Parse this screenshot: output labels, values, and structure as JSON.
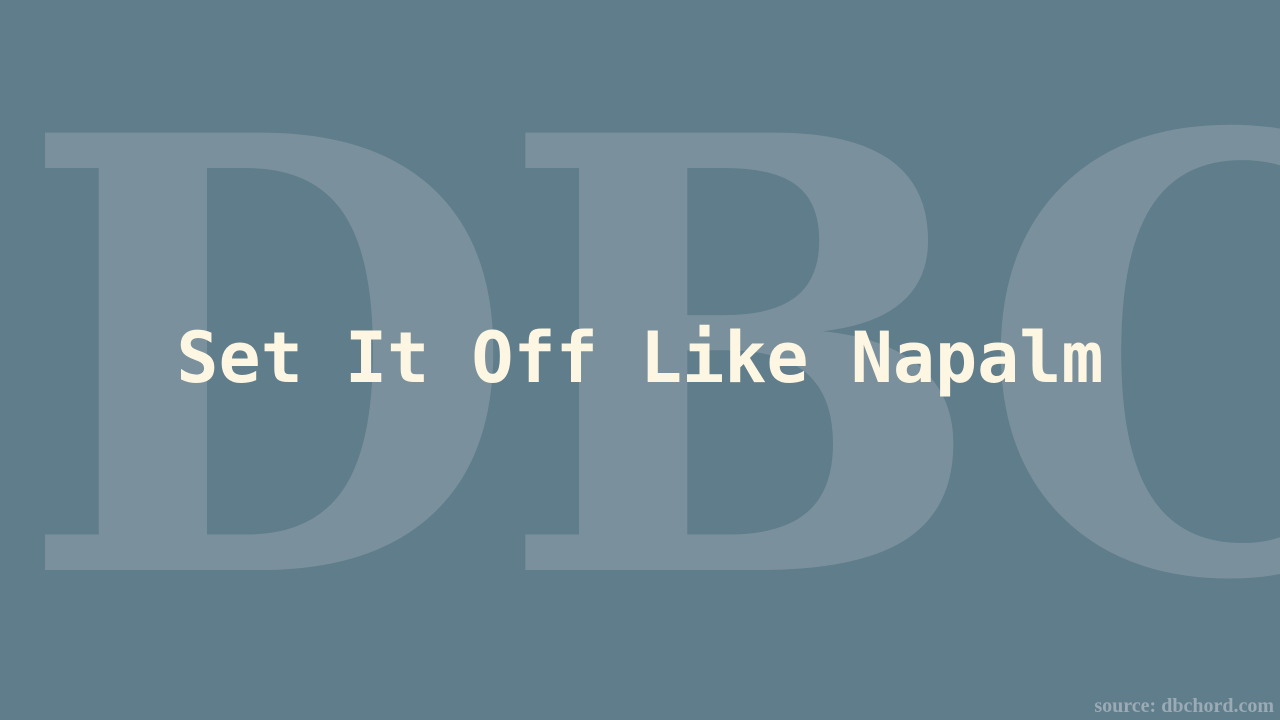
{
  "background_color": "#607d8b",
  "watermark": {
    "text": "DBC",
    "color": "#7a919d"
  },
  "title": {
    "text": "Set It Off Like Napalm",
    "color": "#fdf6e3"
  },
  "source": {
    "text": "source: dbchord.com",
    "color": "#9aabb5"
  }
}
